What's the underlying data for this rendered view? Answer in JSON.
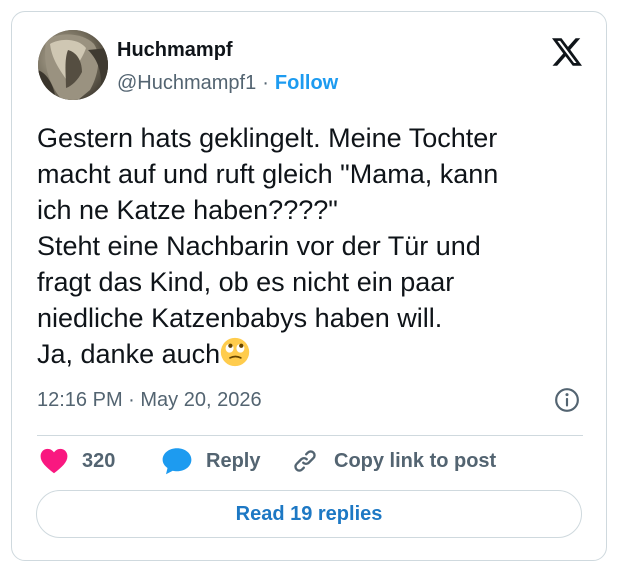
{
  "author": {
    "name": "Huchmampf",
    "handle": "@Huchmampf1",
    "separator": "·",
    "follow_label": "Follow"
  },
  "tweet": {
    "text": "Gestern hats geklingelt. Meine Tochter\nmacht auf und ruft gleich \"Mama, kann\nich ne Katze haben????\"\nSteht eine Nachbarin vor der Tür und\nfragt das Kind, ob es nicht ein paar\nniedliche Katzenbabys haben will.\nJa, danke auch",
    "trailing_emoji": "face-with-rolling-eyes",
    "timestamp": "12:16 PM · May 20, 2026"
  },
  "actions": {
    "like_count": "320",
    "reply_label": "Reply",
    "copy_link_label": "Copy link to post"
  },
  "read_replies_label": "Read 19 replies",
  "icons": {
    "logo": "x-logo-icon",
    "info": "info-icon",
    "like": "heart-icon",
    "reply": "speech-bubble-icon",
    "copy": "link-icon"
  },
  "colors": {
    "accent": "#1d9bf0",
    "like": "#f91880",
    "text": "#0f1419",
    "secondary": "#536471",
    "border": "#cfd9de"
  }
}
